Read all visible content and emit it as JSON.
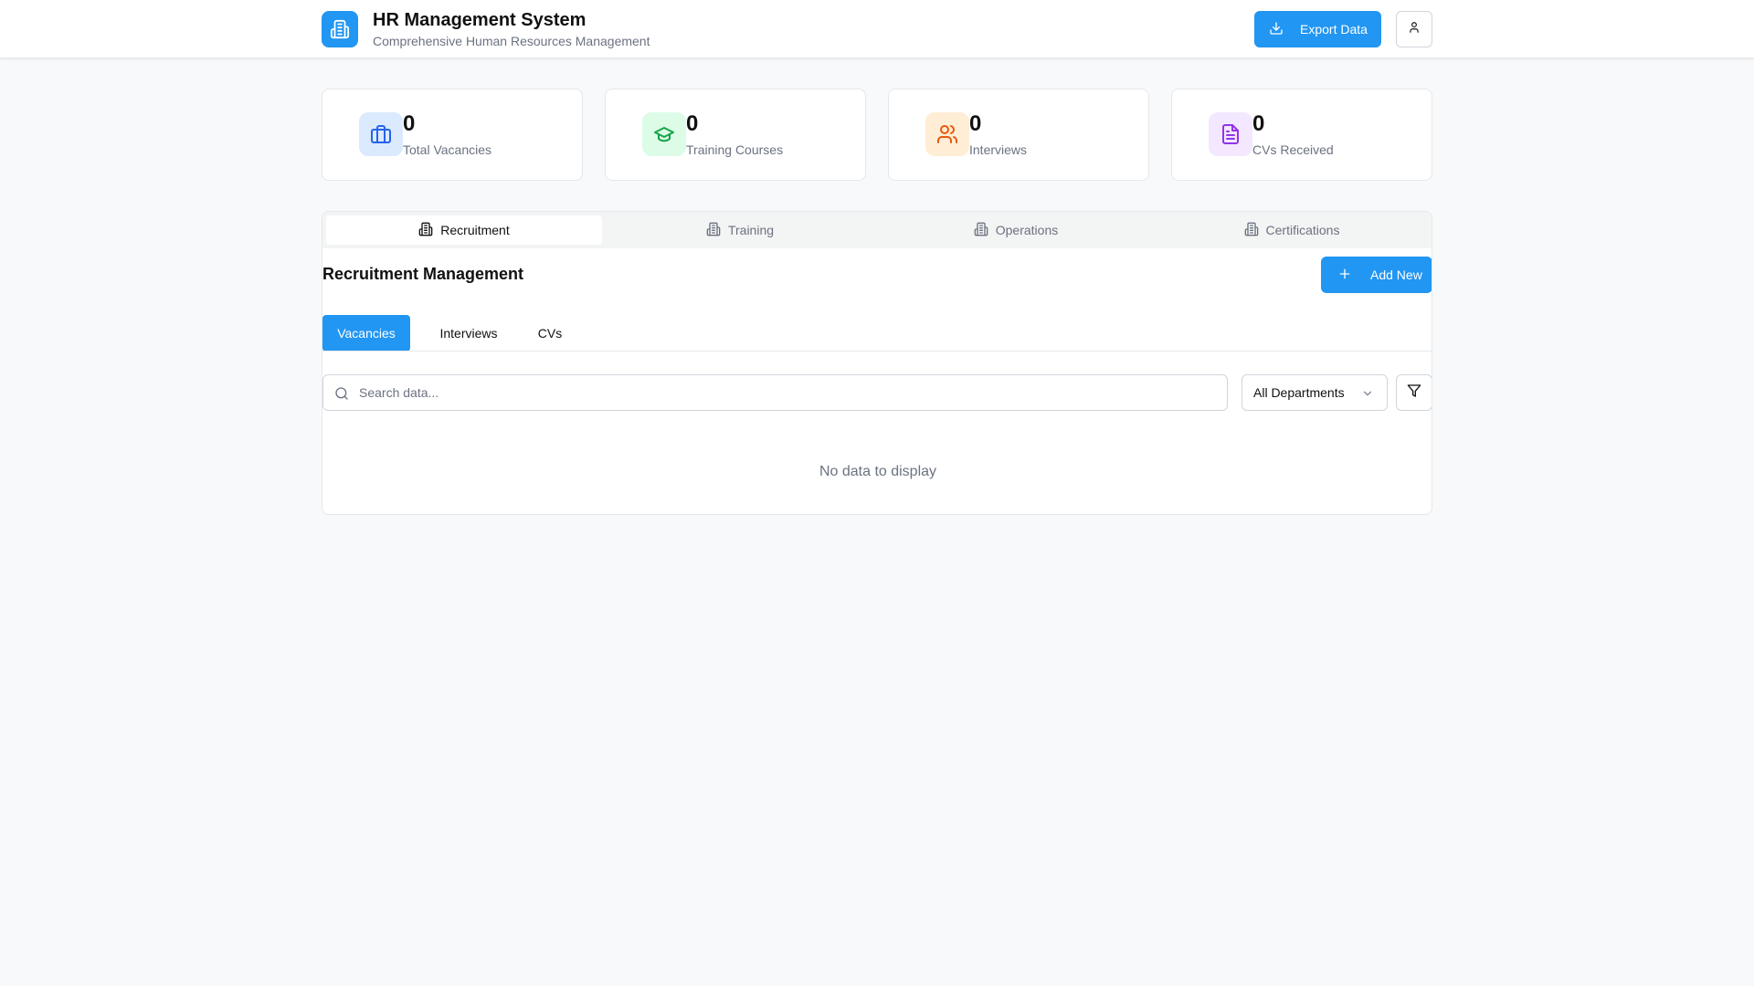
{
  "header": {
    "title": "HR Management System",
    "subtitle": "Comprehensive Human Resources Management",
    "export_label": "Export Data",
    "logo_icon": "building-icon",
    "user_icon": "user-icon"
  },
  "stats": [
    {
      "value": "0",
      "label": "Total Vacancies",
      "icon": "briefcase-icon",
      "bg": "#dbeafe",
      "color": "#2563eb"
    },
    {
      "value": "0",
      "label": "Training Courses",
      "icon": "graduation-cap-icon",
      "bg": "#dcfce7",
      "color": "#16a34a"
    },
    {
      "value": "0",
      "label": "Interviews",
      "icon": "users-icon",
      "bg": "#ffedd5",
      "color": "#ea580c"
    },
    {
      "value": "0",
      "label": "CVs Received",
      "icon": "file-text-icon",
      "bg": "#f3e8ff",
      "color": "#9333ea"
    }
  ],
  "tabs": [
    {
      "label": "Recruitment",
      "active": true
    },
    {
      "label": "Training",
      "active": false
    },
    {
      "label": "Operations",
      "active": false
    },
    {
      "label": "Certifications",
      "active": false
    }
  ],
  "section": {
    "title": "Recruitment Management",
    "add_label": "Add New"
  },
  "subtabs": [
    {
      "label": "Vacancies",
      "active": true
    },
    {
      "label": "Interviews",
      "active": false
    },
    {
      "label": "CVs",
      "active": false
    }
  ],
  "search": {
    "placeholder": "Search data...",
    "value": ""
  },
  "filter": {
    "department_selected": "All Departments"
  },
  "empty_message": "No data to display",
  "colors": {
    "accent": "#2196f3",
    "background": "#f8f9fa"
  }
}
